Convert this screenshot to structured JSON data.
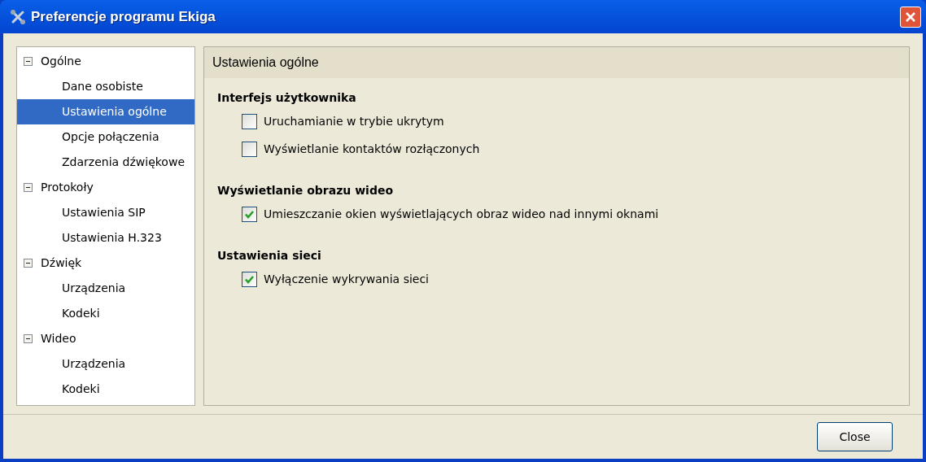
{
  "window": {
    "title": "Preferencje programu Ekiga"
  },
  "sidebar": {
    "items": [
      {
        "label": "Ogólne",
        "expanded": true,
        "children": [
          {
            "label": "Dane osobiste",
            "selected": false
          },
          {
            "label": "Ustawienia ogólne",
            "selected": true
          },
          {
            "label": "Opcje połączenia",
            "selected": false
          },
          {
            "label": "Zdarzenia dźwiękowe",
            "selected": false
          }
        ]
      },
      {
        "label": "Protokoły",
        "expanded": true,
        "children": [
          {
            "label": "Ustawienia SIP",
            "selected": false
          },
          {
            "label": "Ustawienia H.323",
            "selected": false
          }
        ]
      },
      {
        "label": "Dźwięk",
        "expanded": true,
        "children": [
          {
            "label": "Urządzenia",
            "selected": false
          },
          {
            "label": "Kodeki",
            "selected": false
          }
        ]
      },
      {
        "label": "Wideo",
        "expanded": true,
        "children": [
          {
            "label": "Urządzenia",
            "selected": false
          },
          {
            "label": "Kodeki",
            "selected": false
          }
        ]
      }
    ]
  },
  "panel": {
    "title": "Ustawienia ogólne",
    "sections": [
      {
        "heading": "Interfejs użytkownika",
        "options": [
          {
            "label": "Uruchamianie w trybie ukrytym",
            "checked": false
          },
          {
            "label": "Wyświetlanie kontaktów rozłączonych",
            "checked": false
          }
        ]
      },
      {
        "heading": "Wyświetlanie obrazu wideo",
        "options": [
          {
            "label": "Umieszczanie okien wyświetlających obraz wideo nad innymi oknami",
            "checked": true
          }
        ]
      },
      {
        "heading": "Ustawienia sieci",
        "options": [
          {
            "label": "Wyłączenie wykrywania sieci",
            "checked": true
          }
        ]
      }
    ]
  },
  "buttons": [
    "Close"
  ]
}
